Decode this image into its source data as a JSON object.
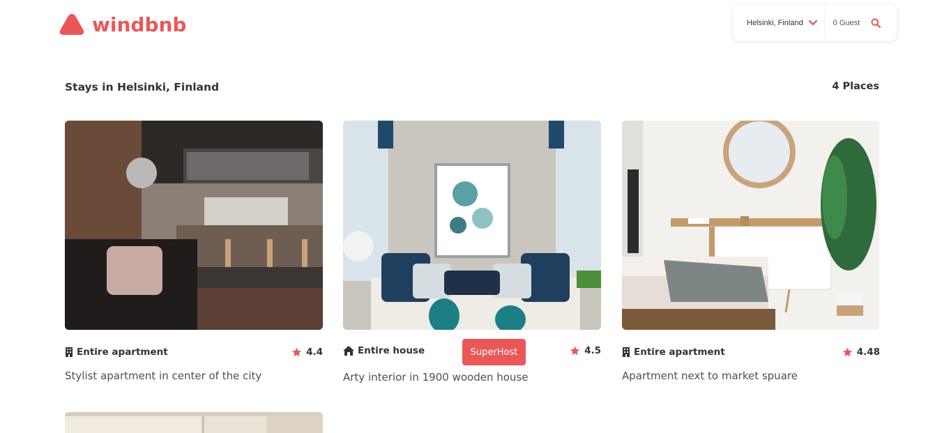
{
  "brand": {
    "name": "windbnb",
    "color": "#EB5757"
  },
  "search": {
    "location": "Helsinki, Finland",
    "guests": "0 Guest"
  },
  "heading": {
    "title": "Stays in Helsinki, Finland",
    "count": "4 Places"
  },
  "stays": [
    {
      "type": "Entire apartment",
      "type_icon": "building-icon",
      "rating": "4.4",
      "title": "Stylist apartment in center of the city",
      "superhost": ""
    },
    {
      "type": "Entire house",
      "type_icon": "home-icon",
      "rating": "4.5",
      "title": "Arty interior in 1900 wooden house",
      "superhost": "SuperHost"
    },
    {
      "type": "Entire apartment",
      "type_icon": "building-icon",
      "rating": "4.48",
      "title": "Apartment next to market spuare",
      "superhost": ""
    }
  ]
}
